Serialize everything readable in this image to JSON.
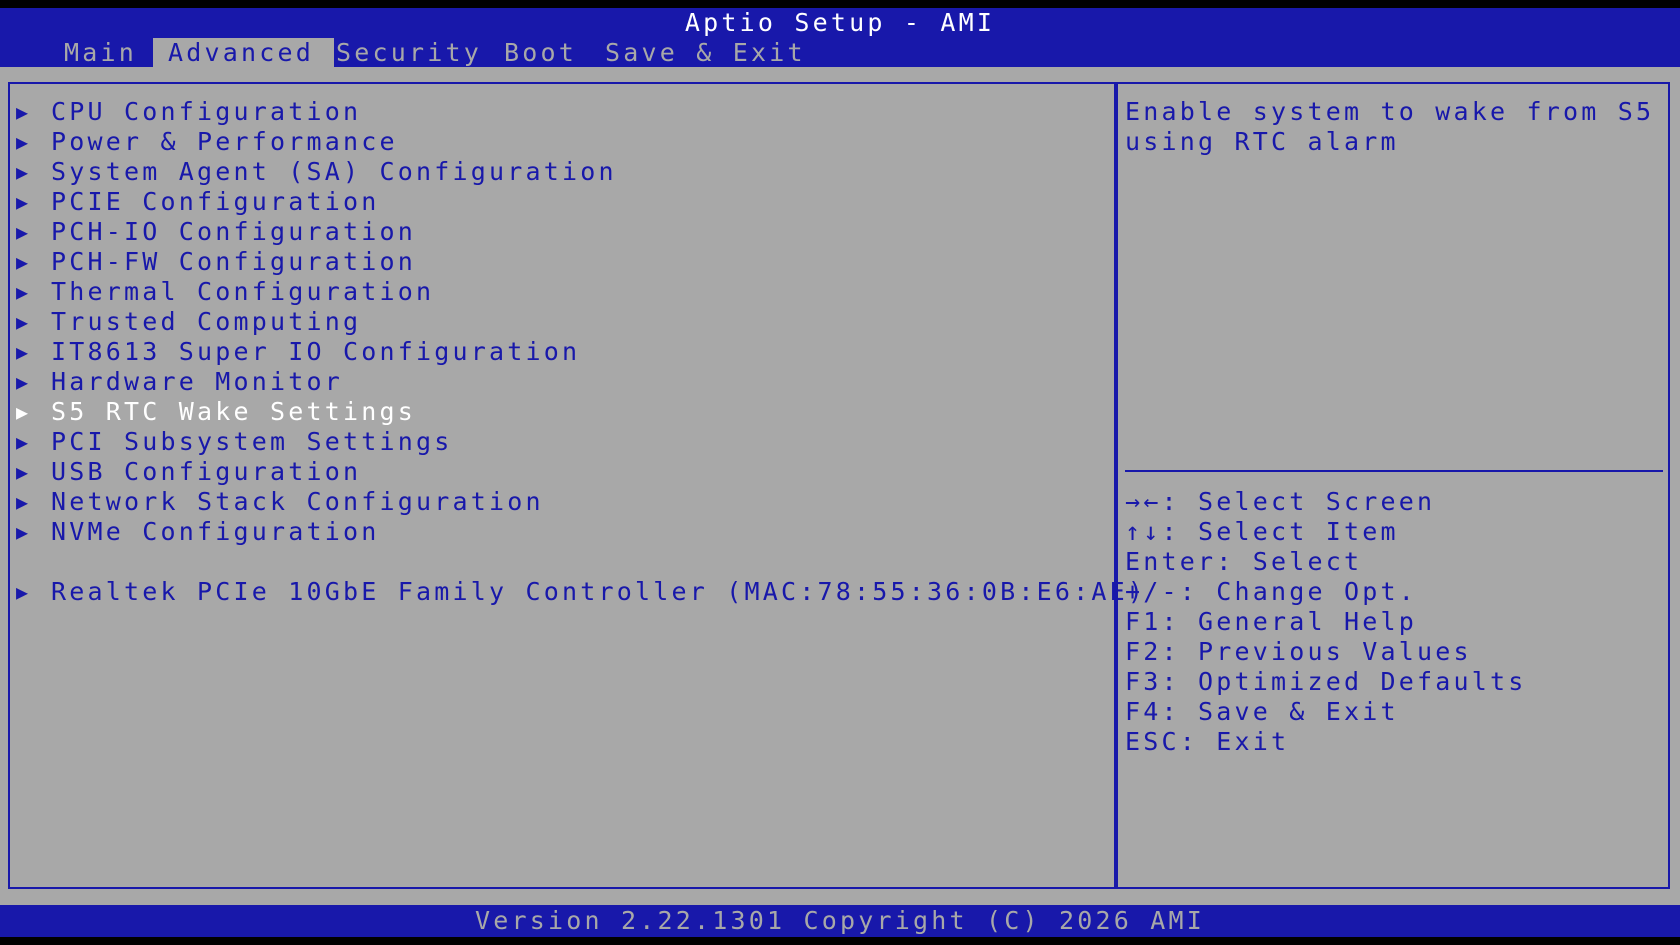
{
  "header": {
    "title": "Aptio Setup - AMI"
  },
  "tabs": [
    {
      "label": "Main",
      "active": false
    },
    {
      "label": "Advanced",
      "active": true
    },
    {
      "label": "Security",
      "active": false
    },
    {
      "label": "Boot",
      "active": false
    },
    {
      "label": "Save & Exit",
      "active": false
    }
  ],
  "menu": {
    "arrow_glyph": "▶",
    "items": [
      {
        "label": "CPU Configuration"
      },
      {
        "label": "Power & Performance"
      },
      {
        "label": "System Agent (SA) Configuration"
      },
      {
        "label": "PCIE Configuration"
      },
      {
        "label": "PCH-IO Configuration"
      },
      {
        "label": "PCH-FW Configuration"
      },
      {
        "label": "Thermal Configuration"
      },
      {
        "label": "Trusted Computing"
      },
      {
        "label": "IT8613 Super IO Configuration"
      },
      {
        "label": "Hardware Monitor"
      },
      {
        "label": "S5 RTC Wake Settings",
        "selected": true
      },
      {
        "label": "PCI Subsystem Settings"
      },
      {
        "label": "USB Configuration"
      },
      {
        "label": "Network Stack Configuration"
      },
      {
        "label": "NVMe Configuration"
      }
    ],
    "extra_item": {
      "label": "Realtek PCIe 10GbE Family Controller (MAC:78:55:36:0B:E6:AE)"
    }
  },
  "help": {
    "text": "Enable system to wake from S5 using RTC alarm"
  },
  "keys": [
    {
      "text": "→←: Select Screen"
    },
    {
      "text": "↑↓: Select Item"
    },
    {
      "text": "Enter: Select"
    },
    {
      "text": "+/-: Change Opt."
    },
    {
      "text": "F1: General Help"
    },
    {
      "text": "F2: Previous Values"
    },
    {
      "text": "F3: Optimized Defaults"
    },
    {
      "text": "F4: Save & Exit"
    },
    {
      "text": "ESC: Exit"
    }
  ],
  "footer": {
    "text": "Version 2.22.1301 Copyright (C) 2026 AMI"
  },
  "colors": {
    "bar_blue": "#1818aa",
    "panel_gray": "#a8a8a8",
    "highlight_white": "#ffffff"
  }
}
